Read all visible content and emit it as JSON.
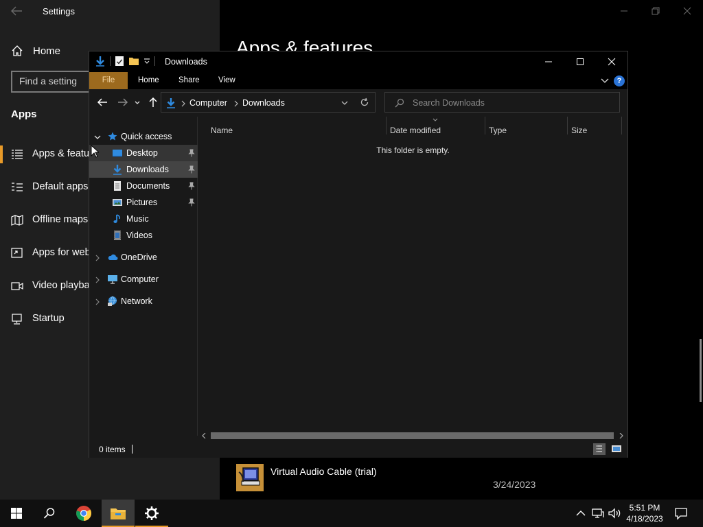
{
  "settings": {
    "title": "Settings",
    "home_label": "Home",
    "search_placeholder": "Find a setting",
    "section_title": "Apps",
    "heading": "Apps & features",
    "nav_items": [
      {
        "label": "Apps & features",
        "icon": "apps-features-icon",
        "active": true
      },
      {
        "label": "Default apps",
        "icon": "default-apps-icon"
      },
      {
        "label": "Offline maps",
        "icon": "offline-maps-icon"
      },
      {
        "label": "Apps for websites",
        "icon": "apps-for-websites-icon"
      },
      {
        "label": "Video playback",
        "icon": "video-playback-icon"
      },
      {
        "label": "Startup",
        "icon": "startup-icon"
      }
    ],
    "app_entry": {
      "name": "Virtual Audio Cable (trial)",
      "date": "3/24/2023"
    }
  },
  "explorer": {
    "title": "Downloads",
    "ribbon_tabs": [
      "File",
      "Home",
      "Share",
      "View"
    ],
    "breadcrumb": [
      "Computer",
      "Downloads"
    ],
    "search_placeholder": "Search Downloads",
    "tree": [
      {
        "label": "Quick access",
        "icon": "star-icon",
        "level": 0,
        "expanded": true
      },
      {
        "label": "Desktop",
        "icon": "desktop-folder-icon",
        "level": 1,
        "pinned": true,
        "hover": true
      },
      {
        "label": "Downloads",
        "icon": "downloads-folder-icon",
        "level": 1,
        "pinned": true,
        "selected": true
      },
      {
        "label": "Documents",
        "icon": "documents-folder-icon",
        "level": 1,
        "pinned": true
      },
      {
        "label": "Pictures",
        "icon": "pictures-folder-icon",
        "level": 1,
        "pinned": true
      },
      {
        "label": "Music",
        "icon": "music-icon",
        "level": 1
      },
      {
        "label": "Videos",
        "icon": "videos-folder-icon",
        "level": 1
      },
      {
        "label": "OneDrive",
        "icon": "onedrive-cloud-icon",
        "level": 0
      },
      {
        "label": "Computer",
        "icon": "computer-icon",
        "level": 0
      },
      {
        "label": "Network",
        "icon": "network-icon",
        "level": 0
      }
    ],
    "columns": [
      "Name",
      "Date modified",
      "Type",
      "Size"
    ],
    "empty_message": "This folder is empty.",
    "status_text": "0 items"
  },
  "taskbar": {
    "time": "5:51 PM",
    "date": "4/18/2023",
    "apps": [
      "start-icon",
      "search-icon",
      "chrome-icon",
      "file-explorer-icon",
      "settings-gear-icon"
    ]
  },
  "colors": {
    "accent": "#e89a28",
    "file_tab": "#9c6a1e",
    "selection": "#444444",
    "folder_blue": "#2f8be0"
  }
}
